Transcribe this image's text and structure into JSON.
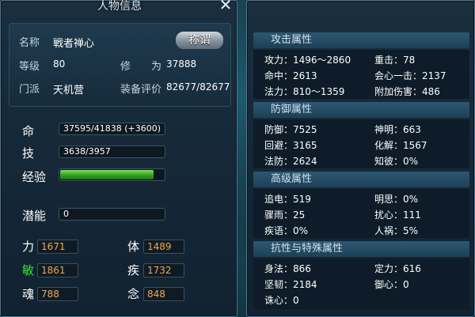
{
  "left": {
    "title": "人物信息",
    "close_icon": "close-icon",
    "info": {
      "name_label": "名称",
      "name_value": "戦者禅心",
      "title_button": "称谓",
      "level_label": "等级",
      "level_value": "80",
      "cultivation_label": "修　　为",
      "cultivation_value": "37888",
      "faction_label": "门派",
      "faction_value": "天机营",
      "equip_label": "装备评价",
      "equip_value": "82677/82677"
    },
    "vitals": {
      "life_label": "命",
      "life_value": "37595/41838 (+3600)",
      "skill_label": "技",
      "skill_value": "3638/3957",
      "exp_label": "经验",
      "exp_fraction": 0.9
    },
    "potential": {
      "label": "潜能",
      "value": "0"
    },
    "attributes": [
      {
        "label": "力",
        "value": "1671"
      },
      {
        "label": "体",
        "value": "1489"
      },
      {
        "label": "敏",
        "value": "1861"
      },
      {
        "label": "疾",
        "value": "1732"
      },
      {
        "label": "魂",
        "value": "788"
      },
      {
        "label": "念",
        "value": "848"
      }
    ]
  },
  "right": {
    "attack": {
      "header": "攻击属性",
      "items": [
        "攻力：1496～2860",
        "重击：78",
        "命中：2613",
        "会心一击：2137",
        "法力：810～1359",
        "附加伤害：486"
      ]
    },
    "defense": {
      "header": "防御属性",
      "items": [
        "防御：7525",
        "神明：663",
        "回避：3165",
        "化解：1567",
        "法防：2624",
        "知彼：0%"
      ]
    },
    "advanced": {
      "header": "高级属性",
      "items": [
        "追电：519",
        "明思：0%",
        "骤雨：25",
        "扰心：111",
        "疾语：0%",
        "人祸：5%"
      ]
    },
    "special": {
      "header": "抗性与特殊属性",
      "items": [
        "身法：866",
        "定力：616",
        "坚韧：2184",
        "御心：0",
        "诛心：0"
      ]
    }
  }
}
